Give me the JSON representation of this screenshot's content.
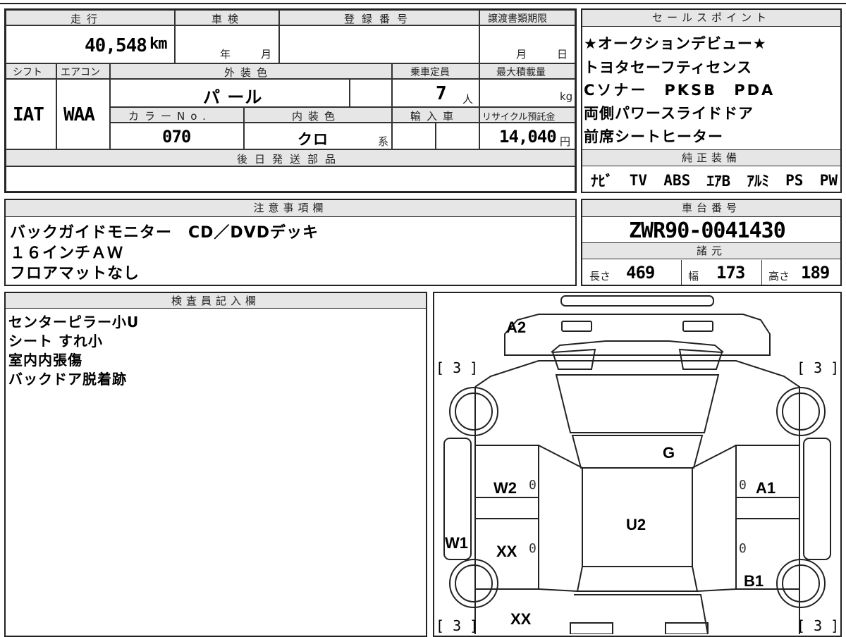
{
  "top_row": {
    "mileage_label": "走行",
    "mileage_value": "40,548",
    "mileage_unit": "km",
    "inspection_label": "車検",
    "inspection_year": "年",
    "inspection_month": "月",
    "registration_label": "登録番号",
    "deadline_label": "譲渡書類期限",
    "deadline_month": "月",
    "deadline_day": "日"
  },
  "second_row": {
    "shift_label": "シフト",
    "aircon_label": "エアコン",
    "exterior_label": "外装色",
    "capacity_label": "乗車定員",
    "max_load_label": "最大積載量",
    "shift_value": "IAT",
    "aircon_value": "WAA",
    "exterior_value": "パ ール",
    "capacity_value": "7",
    "capacity_unit": "人",
    "max_load_unit": "kg",
    "color_no_label": "カラーNo.",
    "interior_label": "内装色",
    "import_label": "輸入車",
    "recycle_label": "リサイクル預託金",
    "color_no_value": "070",
    "interior_value": "クロ",
    "interior_suffix": "系",
    "recycle_value": "14,040",
    "recycle_unit": "円"
  },
  "later_parts": {
    "label": "後日発送部品",
    "value": ""
  },
  "sales_points": {
    "label": "セールスポイント",
    "lines": [
      "★オークションデビュー★",
      "トヨタセーフティセンス",
      "Cソナー　PKSB　PDA",
      "両側パワースライドドア",
      "前席シートヒーター"
    ]
  },
  "genuine_equipment": {
    "label": "純正装備",
    "items": [
      "ﾅﾋﾞ",
      "TV",
      "ABS",
      "ｴｱB",
      "ｱﾙﾐ",
      "PS",
      "PW"
    ]
  },
  "notes": {
    "label": "注意事項欄",
    "lines": [
      "バックガイドモニター　CD／DVDデッキ",
      "１６インチＡＷ",
      "フロアマットなし"
    ]
  },
  "chassis": {
    "label": "車台番号",
    "value": "ZWR90-0041430",
    "specs_label": "諸元",
    "length_label": "長さ",
    "length_value": "469",
    "width_label": "幅",
    "width_value": "173",
    "height_label": "高さ",
    "height_value": "189"
  },
  "inspector": {
    "label": "検査員記入欄",
    "lines": [
      "センターピラー小U",
      "シート すれ小",
      "室内内張傷",
      "バックドア脱着跡"
    ]
  },
  "diagram": {
    "marks": {
      "a2": "A2",
      "g": "G",
      "w2": "W2",
      "a1": "A1",
      "u2": "U2",
      "w1": "W1",
      "xx1": "XX",
      "b1": "B1",
      "xx2": "XX",
      "zero1": "0",
      "zero2": "0",
      "zero3": "0",
      "zero4": "0"
    },
    "tires": {
      "front_left": "[ 3 ]",
      "front_right": "[ 3 ]",
      "rear_left": "[ 3 ]",
      "rear_right": "[ 3 ]"
    }
  }
}
